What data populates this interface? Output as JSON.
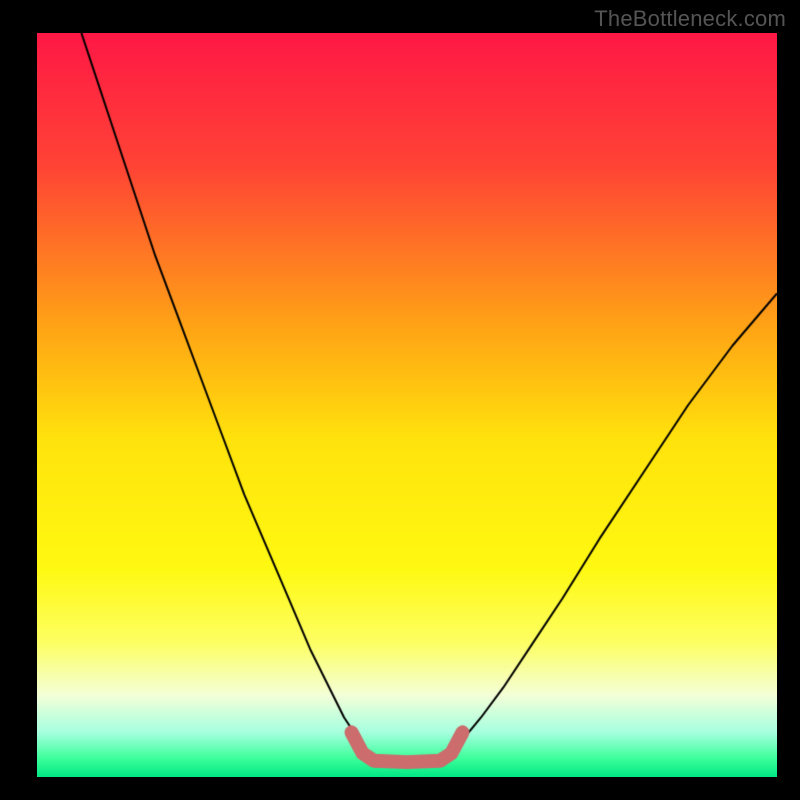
{
  "watermark": {
    "text": "TheBottleneck.com"
  },
  "chart_data": {
    "type": "line",
    "title": "",
    "xlabel": "",
    "ylabel": "",
    "xlim": [
      0,
      100
    ],
    "ylim": [
      0,
      100
    ],
    "grid": false,
    "background_gradient": {
      "stops": [
        {
          "t": 0.0,
          "color": "#ff1846"
        },
        {
          "t": 0.18,
          "color": "#ff4435"
        },
        {
          "t": 0.4,
          "color": "#ffa615"
        },
        {
          "t": 0.55,
          "color": "#ffe40c"
        },
        {
          "t": 0.72,
          "color": "#fff912"
        },
        {
          "t": 0.82,
          "color": "#fdff64"
        },
        {
          "t": 0.89,
          "color": "#f4ffd8"
        },
        {
          "t": 0.94,
          "color": "#a6ffe0"
        },
        {
          "t": 0.975,
          "color": "#3dff9b"
        },
        {
          "t": 1.0,
          "color": "#00e884"
        }
      ]
    },
    "series": [
      {
        "name": "curve-left",
        "color": "#000000",
        "width": 2,
        "x": [
          6,
          8,
          10,
          13,
          16,
          19,
          22,
          25,
          28,
          31,
          34,
          37,
          39.5,
          41.5,
          43.5,
          45
        ],
        "y": [
          100,
          94,
          88,
          79,
          70,
          62,
          54,
          46,
          38,
          31,
          24,
          17,
          12,
          8,
          5,
          3
        ]
      },
      {
        "name": "curve-right",
        "color": "#000000",
        "width": 2,
        "x": [
          55,
          57.5,
          60,
          63,
          67,
          71,
          76,
          82,
          88,
          94,
          100
        ],
        "y": [
          3,
          5,
          8,
          12,
          18,
          24,
          32,
          41,
          50,
          58,
          65
        ]
      },
      {
        "name": "highlight-band",
        "color": "#cc6c6c",
        "width": 14,
        "linecap": "round",
        "x": [
          42.5,
          44,
          45.5,
          50,
          54.5,
          56,
          57.5
        ],
        "y": [
          6,
          3.2,
          2.2,
          2,
          2.2,
          3.2,
          6
        ]
      }
    ]
  }
}
